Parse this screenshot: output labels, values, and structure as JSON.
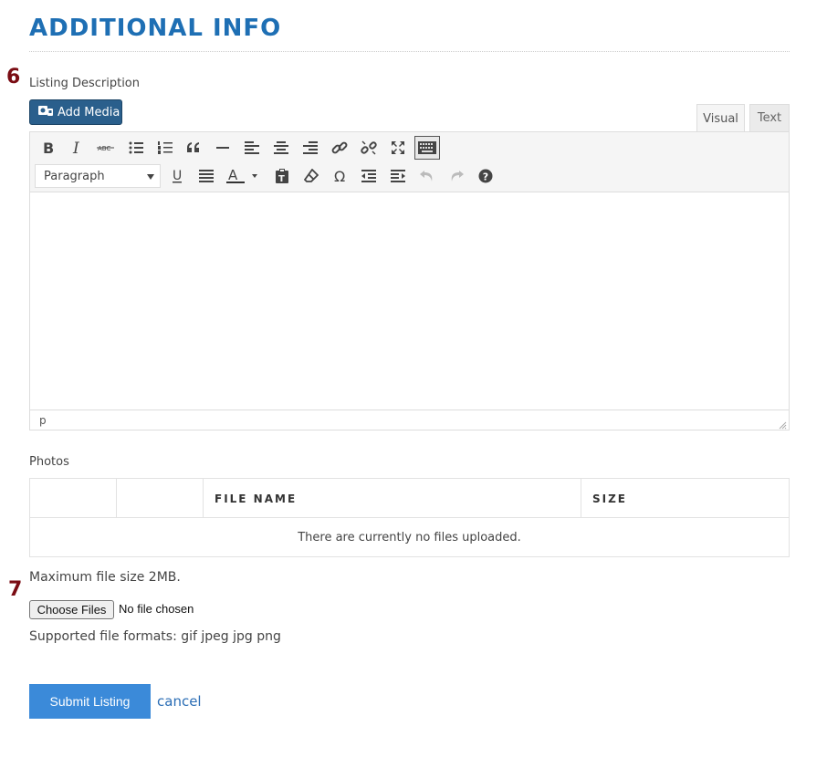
{
  "section": {
    "title": "ADDITIONAL INFO"
  },
  "steps": {
    "description_step": "6",
    "photos_step": "7"
  },
  "description": {
    "label": "Listing Description",
    "add_media_label": "Add Media",
    "tabs": [
      {
        "label": "Visual",
        "active": true
      },
      {
        "label": "Text",
        "active": false
      }
    ],
    "format_select_value": "Paragraph",
    "status_path": "p",
    "toolbar_row1_icons": [
      "bold-icon",
      "italic-icon",
      "strikethrough-icon",
      "bullet-list-icon",
      "numbered-list-icon",
      "blockquote-icon",
      "horizontal-line-icon",
      "align-left-icon",
      "align-center-icon",
      "align-right-icon",
      "link-icon",
      "unlink-icon",
      "fullscreen-icon",
      "toolbar-toggle-icon"
    ],
    "toolbar_row2_icons": [
      "underline-icon",
      "justify-icon",
      "text-color-icon",
      "paste-text-icon",
      "clear-formatting-icon",
      "special-character-icon",
      "outdent-icon",
      "indent-icon",
      "undo-icon",
      "redo-icon",
      "help-icon"
    ]
  },
  "photos": {
    "label": "Photos",
    "columns": [
      "",
      "",
      "FILE NAME",
      "SIZE"
    ],
    "empty_message": "There are currently no files uploaded.",
    "max_size_text": "Maximum file size 2MB.",
    "choose_files_label": "Choose Files",
    "no_file_text": "No file chosen",
    "supported_formats_text": "Supported file formats: gif jpeg jpg png"
  },
  "actions": {
    "submit_label": "Submit Listing",
    "cancel_label": "cancel"
  },
  "colors": {
    "title": "#1e6fb4",
    "step_number": "#7a0c13",
    "add_media_bg": "#2a5f8c",
    "submit_bg": "#3b8ad9",
    "link": "#2a6db5"
  }
}
